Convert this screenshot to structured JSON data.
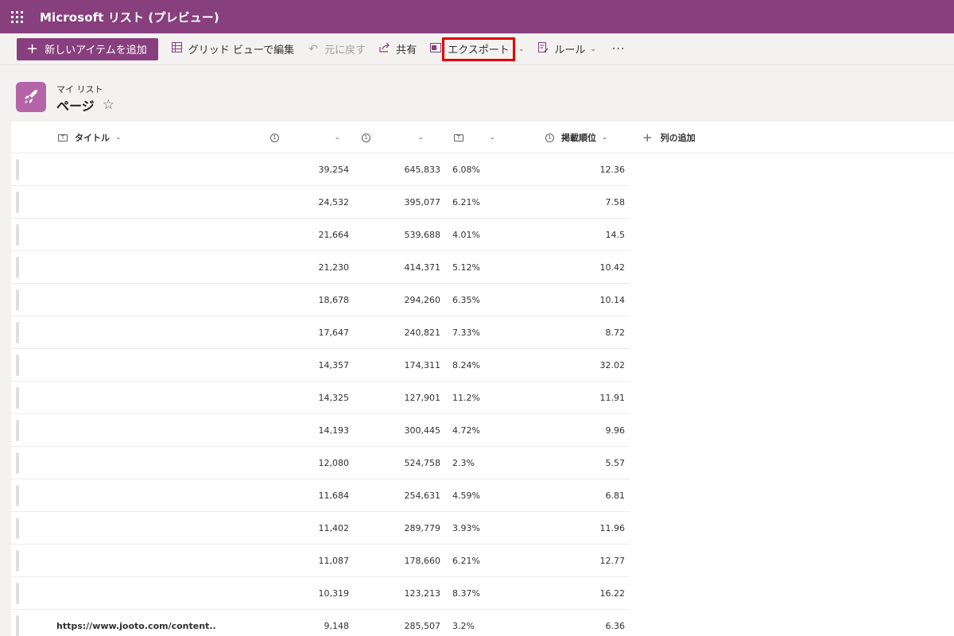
{
  "app": {
    "title": "Microsoft リスト (プレビュー)"
  },
  "commands": {
    "new_item": "新しいアイテムを追加",
    "grid_edit": "グリッド ビューで編集",
    "undo": "元に戻す",
    "share": "共有",
    "export": "エクスポート",
    "rules": "ルール",
    "more": "···"
  },
  "header": {
    "breadcrumb": "マイ リスト",
    "title": "ページ",
    "favorite_icon": "☆"
  },
  "columns": {
    "title": "タイトル",
    "col1": "",
    "col2": "",
    "col3": "",
    "rank": "掲載順位",
    "add": "列の追加"
  },
  "rows": [
    {
      "title": "",
      "v1": "39,254",
      "v2": "645,833",
      "v3": "6.08%",
      "v4": "12.36"
    },
    {
      "title": "",
      "v1": "24,532",
      "v2": "395,077",
      "v3": "6.21%",
      "v4": "7.58"
    },
    {
      "title": "",
      "v1": "21,664",
      "v2": "539,688",
      "v3": "4.01%",
      "v4": "14.5"
    },
    {
      "title": "",
      "v1": "21,230",
      "v2": "414,371",
      "v3": "5.12%",
      "v4": "10.42"
    },
    {
      "title": "",
      "v1": "18,678",
      "v2": "294,260",
      "v3": "6.35%",
      "v4": "10.14"
    },
    {
      "title": "",
      "v1": "17,647",
      "v2": "240,821",
      "v3": "7.33%",
      "v4": "8.72"
    },
    {
      "title": "",
      "v1": "14,357",
      "v2": "174,311",
      "v3": "8.24%",
      "v4": "32.02"
    },
    {
      "title": "",
      "v1": "14,325",
      "v2": "127,901",
      "v3": "11.2%",
      "v4": "11.91"
    },
    {
      "title": "",
      "v1": "14,193",
      "v2": "300,445",
      "v3": "4.72%",
      "v4": "9.96"
    },
    {
      "title": "",
      "v1": "12,080",
      "v2": "524,758",
      "v3": "2.3%",
      "v4": "5.57"
    },
    {
      "title": "",
      "v1": "11,684",
      "v2": "254,631",
      "v3": "4.59%",
      "v4": "6.81"
    },
    {
      "title": "",
      "v1": "11,402",
      "v2": "289,779",
      "v3": "3.93%",
      "v4": "11.96"
    },
    {
      "title": "",
      "v1": "11,087",
      "v2": "178,660",
      "v3": "6.21%",
      "v4": "12.77"
    },
    {
      "title": "",
      "v1": "10,319",
      "v2": "123,213",
      "v3": "8.37%",
      "v4": "16.22"
    },
    {
      "title": "https://www.jooto.com/content...",
      "v1": "9,148",
      "v2": "285,507",
      "v3": "3.2%",
      "v4": "6.36"
    }
  ],
  "colors": {
    "brand": "#883f7e",
    "highlight": "#e00000"
  }
}
